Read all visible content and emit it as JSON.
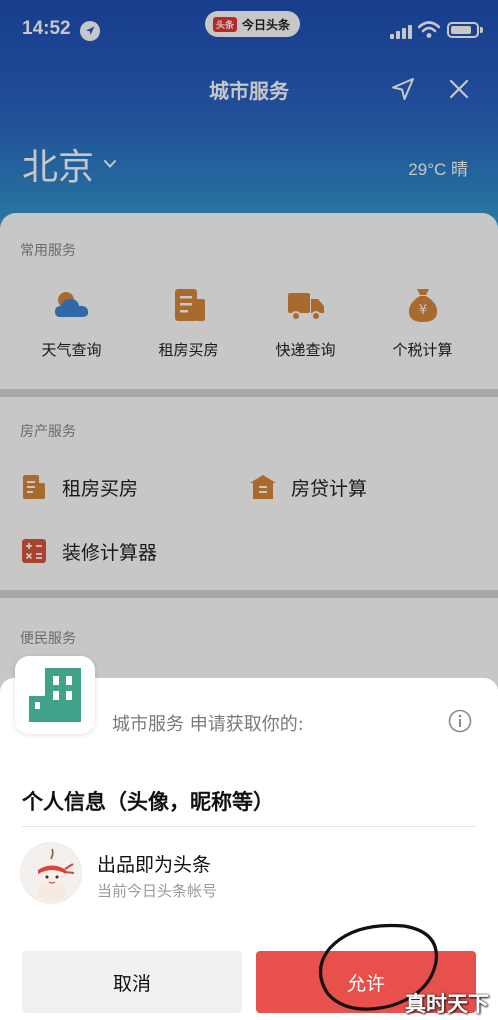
{
  "status": {
    "time": "14:52",
    "app_badge": "今日头条",
    "app_logo": "头条"
  },
  "nav": {
    "title": "城市服务"
  },
  "city": {
    "name": "北京",
    "weather": "29°C 晴"
  },
  "common_services": {
    "title": "常用服务",
    "items": [
      {
        "label": "天气查询",
        "icon": "cloud-icon"
      },
      {
        "label": "租房买房",
        "icon": "document-icon"
      },
      {
        "label": "快递查询",
        "icon": "truck-icon"
      },
      {
        "label": "个税计算",
        "icon": "money-bag-icon"
      }
    ]
  },
  "house_services": {
    "title": "房产服务",
    "items": [
      {
        "label": "租房买房",
        "icon": "document-icon"
      },
      {
        "label": "房贷计算",
        "icon": "house-icon"
      },
      {
        "label": "装修计算器",
        "icon": "calculator-icon"
      }
    ]
  },
  "people_services": {
    "title": "便民服务"
  },
  "permission": {
    "request_text": "城市服务 申请获取你的:",
    "title": "个人信息（头像，昵称等）",
    "account_name": "出品即为头条",
    "account_sub": "当前今日头条帐号",
    "cancel_label": "取消",
    "allow_label": "允许"
  },
  "watermark": "真时天下",
  "colors": {
    "accent_orange": "#d9893a",
    "weather_blue": "#3e86d8",
    "allow_red": "#e8504b",
    "app_green": "#3fa38a",
    "calc_red": "#d9573c"
  }
}
